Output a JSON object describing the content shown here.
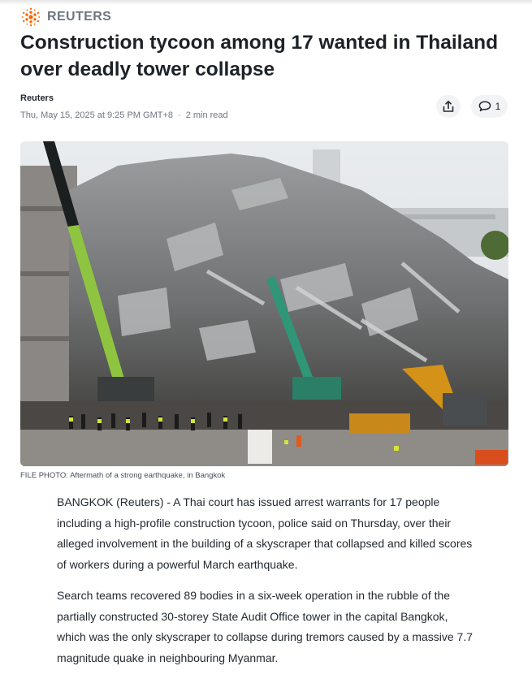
{
  "brand": {
    "name": "REUTERS",
    "logo_icon": "reuters-dot-logo",
    "logo_color": "#fa6400"
  },
  "article": {
    "headline": "Construction tycoon among 17 wanted in Thailand over deadly tower collapse",
    "author": "Reuters",
    "timestamp": "Thu, May 15, 2025 at 9:25 PM GMT+8",
    "separator": "·",
    "read_time": "2 min read",
    "comment_count": "1",
    "image_caption": "FILE PHOTO: Aftermath of a strong earthquake, in Bangkok",
    "paragraphs": [
      "BANGKOK (Reuters) - A Thai court has issued arrest warrants for 17 people including a high-profile construction tycoon, police said on Thursday, over their alleged involvement in the building of a skyscraper that collapsed and killed scores of workers during a powerful March earthquake.",
      "Search teams recovered 89 bodies in a six-week operation in the rubble of the partially constructed 30-storey State Audit Office tower in the capital Bangkok, which was the only skyscraper to collapse during tremors caused by a massive 7.7 magnitude quake in neighbouring Myanmar."
    ]
  },
  "icons": {
    "share": "share-icon",
    "comment": "comment-icon"
  },
  "colors": {
    "text": "#232a31",
    "muted": "#6e7780",
    "button_bg": "#f2f3f5"
  }
}
